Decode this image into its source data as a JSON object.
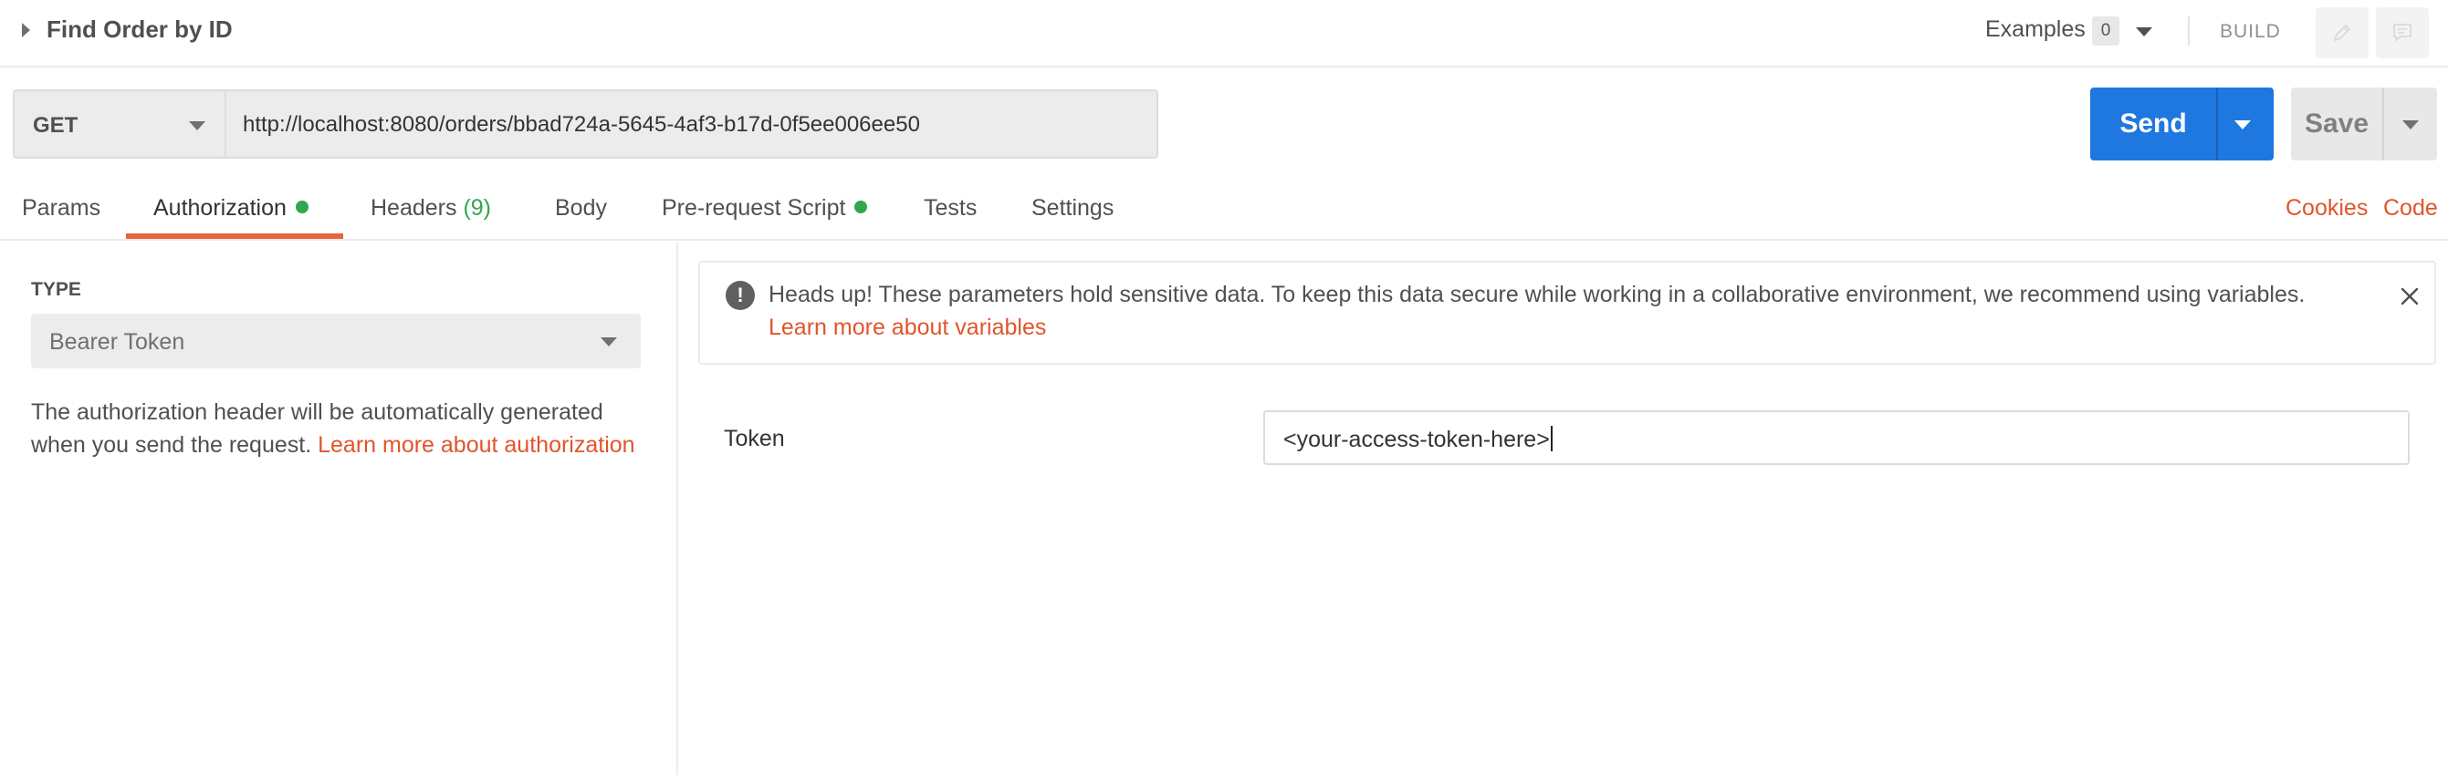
{
  "titlebar": {
    "title": "Find Order by ID",
    "examples_label": "Examples",
    "examples_count": "0",
    "build_label": "BUILD"
  },
  "request": {
    "method": "GET",
    "url": "http://localhost:8080/orders/bbad724a-5645-4af3-b17d-0f5ee006ee50",
    "send_label": "Send",
    "save_label": "Save"
  },
  "tabs": [
    {
      "label": "Params"
    },
    {
      "label": "Authorization",
      "active": true,
      "has_dot": true
    },
    {
      "label": "Headers",
      "count": "(9)"
    },
    {
      "label": "Body"
    },
    {
      "label": "Pre-request Script",
      "has_dot": true
    },
    {
      "label": "Tests"
    },
    {
      "label": "Settings"
    }
  ],
  "right_links": {
    "cookies": "Cookies",
    "code": "Code"
  },
  "auth": {
    "type_label": "TYPE",
    "type_value": "Bearer Token",
    "description": "The authorization header will be automatically generated when you send the request.",
    "learn_more": "Learn more about authorization"
  },
  "notice": {
    "text": "Heads up! These parameters hold sensitive data. To keep this data secure while working in a collaborative environment, we recommend using variables.",
    "link": "Learn more about variables"
  },
  "token": {
    "label": "Token",
    "value": "<your-access-token-here>"
  },
  "colors": {
    "accent_orange": "#e8643c",
    "send_blue": "#1f77e0",
    "status_green": "#2fa84f"
  }
}
